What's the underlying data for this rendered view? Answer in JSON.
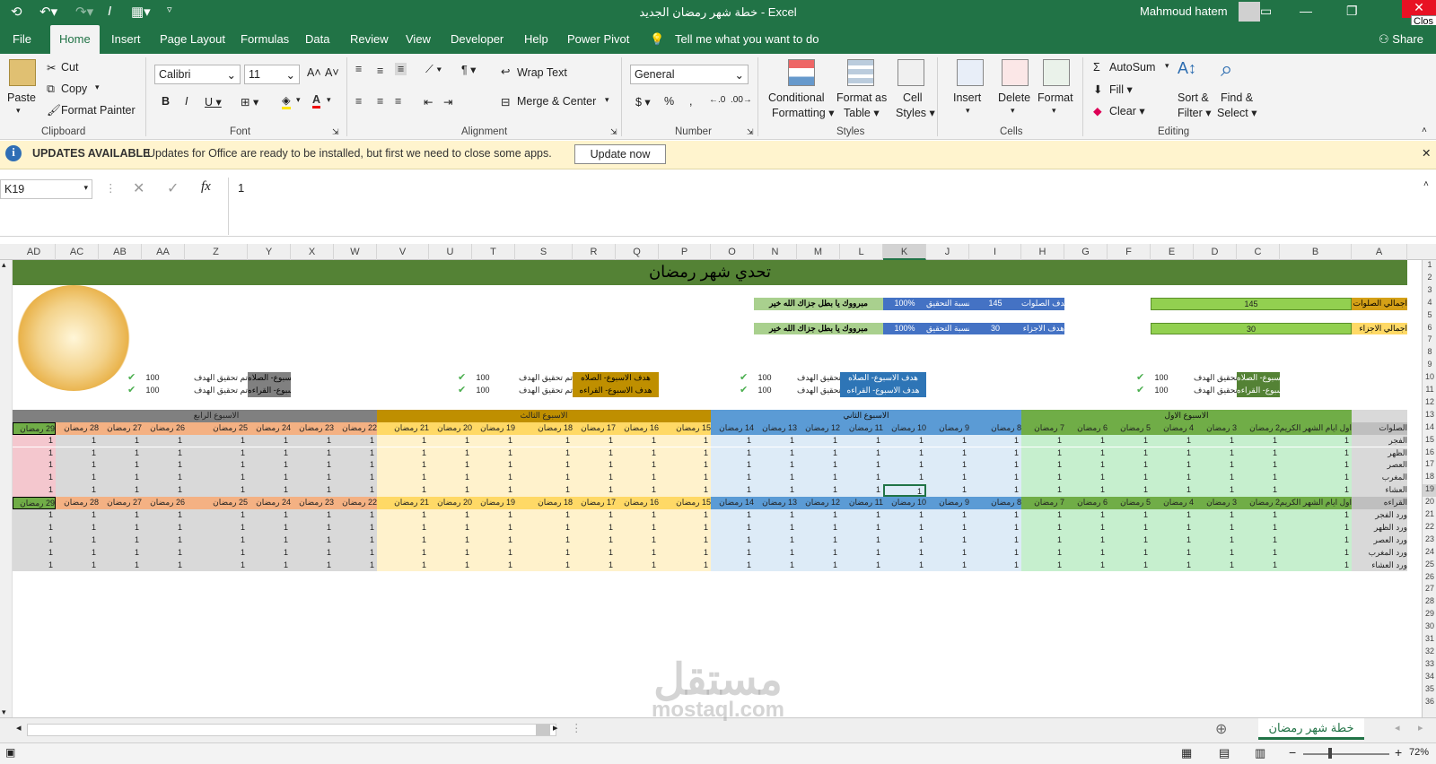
{
  "window": {
    "title": "خطة شهر رمضان الجديد  -  Excel",
    "user": "Mahmoud hatem",
    "close_tooltip": "Clos"
  },
  "tabs": [
    "File",
    "Home",
    "Insert",
    "Page Layout",
    "Formulas",
    "Data",
    "Review",
    "View",
    "Developer",
    "Help",
    "Power Pivot"
  ],
  "tell_me": "Tell me what you want to do",
  "share": "Share",
  "ribbon": {
    "clipboard": {
      "paste": "Paste",
      "cut": "Cut",
      "copy": "Copy",
      "format_painter": "Format Painter",
      "label": "Clipboard"
    },
    "font": {
      "name": "Calibri",
      "size": "11",
      "label": "Font"
    },
    "alignment": {
      "wrap": "Wrap Text",
      "merge": "Merge & Center",
      "label": "Alignment"
    },
    "number": {
      "format": "General",
      "label": "Number"
    },
    "styles": {
      "cond1": "Conditional",
      "cond2": "Formatting",
      "fmt1": "Format as",
      "fmt2": "Table",
      "cell1": "Cell",
      "cell2": "Styles",
      "label": "Styles"
    },
    "cells": {
      "insert": "Insert",
      "delete": "Delete",
      "format": "Format",
      "label": "Cells"
    },
    "editing": {
      "autosum": "AutoSum",
      "fill": "Fill",
      "clear": "Clear",
      "sort1": "Sort &",
      "sort2": "Filter",
      "find1": "Find &",
      "find2": "Select",
      "label": "Editing"
    }
  },
  "update_bar": {
    "title": "UPDATES AVAILABLE",
    "message": "Updates for Office are ready to be installed, but first we need to close some apps.",
    "button": "Update now"
  },
  "formula_bar": {
    "name_box": "K19",
    "value": "1"
  },
  "columns": [
    {
      "id": "AD",
      "w": 48
    },
    {
      "id": "AC",
      "w": 48
    },
    {
      "id": "AB",
      "w": 48
    },
    {
      "id": "AA",
      "w": 48
    },
    {
      "id": "Z",
      "w": 70
    },
    {
      "id": "Y",
      "w": 48
    },
    {
      "id": "X",
      "w": 48
    },
    {
      "id": "W",
      "w": 48
    },
    {
      "id": "V",
      "w": 58
    },
    {
      "id": "U",
      "w": 48
    },
    {
      "id": "T",
      "w": 48
    },
    {
      "id": "S",
      "w": 64
    },
    {
      "id": "R",
      "w": 48
    },
    {
      "id": "Q",
      "w": 48
    },
    {
      "id": "P",
      "w": 58
    },
    {
      "id": "O",
      "w": 48
    },
    {
      "id": "N",
      "w": 48
    },
    {
      "id": "M",
      "w": 48
    },
    {
      "id": "L",
      "w": 48
    },
    {
      "id": "K",
      "w": 48
    },
    {
      "id": "J",
      "w": 48
    },
    {
      "id": "I",
      "w": 58
    },
    {
      "id": "H",
      "w": 48
    },
    {
      "id": "G",
      "w": 48
    },
    {
      "id": "F",
      "w": 48
    },
    {
      "id": "E",
      "w": 48
    },
    {
      "id": "D",
      "w": 48
    },
    {
      "id": "C",
      "w": 48
    },
    {
      "id": "B",
      "w": 80
    },
    {
      "id": "A",
      "w": 62
    }
  ],
  "rows": [
    "1",
    "2",
    "3",
    "4",
    "5",
    "6",
    "7",
    "8",
    "9",
    "10",
    "11",
    "12",
    "13",
    "14",
    "15",
    "16",
    "17",
    "18",
    "19",
    "20",
    "21",
    "22",
    "23",
    "24",
    "25",
    "26",
    "27",
    "28",
    "29",
    "30",
    "31",
    "32",
    "33",
    "34",
    "35",
    "36"
  ],
  "sheet": {
    "title": "تحدي شهر رمضان",
    "total_prayers_label": "اجمالي الصلوات",
    "total_prayers": "145",
    "total_juz_label": "اجمالي الاجزاء",
    "total_juz": "30",
    "goal_prayers_label": "هدف الصلوات",
    "goal_prayers": "145",
    "goal_juz_label": "هدف الاجزاء",
    "goal_juz": "30",
    "ratio_label": "نسبة التحقيق",
    "ratio_value": "100%",
    "congrats": "مبرووك يا بطل جزاك الله خير",
    "week_prayer_goal": "هدف الاسبوع- الصلاه",
    "week_read_goal": "هدف الاسبوع- القراءه",
    "achieved": "تم تحقيق الهدف",
    "achieved_value": "100",
    "weeks": [
      "الاسبوع الاول",
      "الاسبوع الثاني",
      "الاسبوع الثالث",
      "الاسبوع الرابع"
    ],
    "prayers_header": "الصلوات",
    "reading_header": "القراءه",
    "first_day": "اول ايام الشهر الكريم",
    "day_suffix": "رمضان",
    "prayers": [
      "الفجر",
      "الظهر",
      "العصر",
      "المغرب",
      "العشاء"
    ],
    "readings": [
      "ورد الفجر",
      "ورد الظهر",
      "ورد العصر",
      "ورد المغرب",
      "ورد العشاء"
    ],
    "cell_value": "1"
  },
  "sheet_tab": "خطة شهر رمضان",
  "zoom": "72%",
  "watermark": "مستقل",
  "watermark_url": "mostaql.com"
}
